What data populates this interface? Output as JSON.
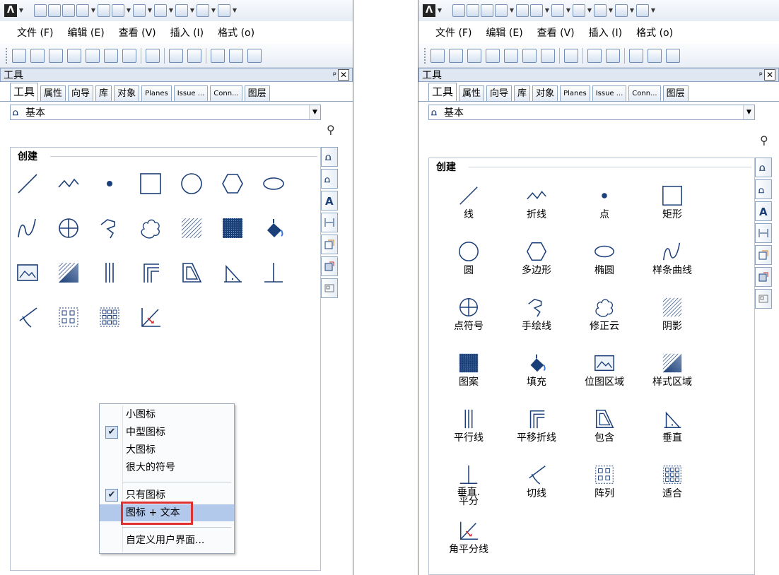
{
  "menu": {
    "file": "文件 (F)",
    "edit": "编辑 (E)",
    "view": "查看 (V)",
    "insert": "插入 (I)",
    "format": "格式 (o)"
  },
  "panel_title": "工具",
  "pin_glyph": "ᴘ",
  "close_glyph": "✕",
  "tabs": [
    "工具",
    "属性",
    "向导",
    "库",
    "对象",
    "Planes",
    "Issue ...",
    "Conn...",
    "图层"
  ],
  "combo_value": "基本",
  "group_title": "创建",
  "context_menu": {
    "small_icons": "小图标",
    "medium_icons": "中型图标",
    "large_icons": "大图标",
    "huge_icons": "很大的符号",
    "icons_only": "只有图标",
    "icons_text": "图标 + 文本",
    "customize": "自定义用户界面..."
  },
  "tools": [
    {
      "label": "线",
      "icon": "line-icon"
    },
    {
      "label": "折线",
      "icon": "polyline-icon"
    },
    {
      "label": "点",
      "icon": "point-icon"
    },
    {
      "label": "矩形",
      "icon": "rectangle-icon"
    },
    {
      "label": "圆",
      "icon": "circle-icon"
    },
    {
      "label": "多边形",
      "icon": "polygon-icon"
    },
    {
      "label": "椭圆",
      "icon": "ellipse-icon"
    },
    {
      "label": "样条曲线",
      "icon": "spline-icon"
    },
    {
      "label": "点符号",
      "icon": "point-symbol-icon"
    },
    {
      "label": "手绘线",
      "icon": "freehand-icon"
    },
    {
      "label": "修正云",
      "icon": "revision-cloud-icon"
    },
    {
      "label": "阴影",
      "icon": "hatch-icon"
    },
    {
      "label": "图案",
      "icon": "pattern-icon"
    },
    {
      "label": "填充",
      "icon": "fill-icon"
    },
    {
      "label": "位图区域",
      "icon": "bitmap-area-icon"
    },
    {
      "label": "样式区域",
      "icon": "style-area-icon"
    },
    {
      "label": "平行线",
      "icon": "parallel-line-icon"
    },
    {
      "label": "平移折线",
      "icon": "offset-polyline-icon"
    },
    {
      "label": "包含",
      "icon": "envelope-icon"
    },
    {
      "label": "垂直",
      "icon": "perpendicular-icon"
    },
    {
      "label": "垂直.\n平分",
      "icon": "perp-bisector-icon"
    },
    {
      "label": "切线",
      "icon": "tangent-icon"
    },
    {
      "label": "阵列",
      "icon": "array-icon"
    },
    {
      "label": "适合",
      "icon": "fit-icon"
    },
    {
      "label": "角平分线",
      "icon": "angle-bisector-icon"
    }
  ],
  "colors": {
    "accent": "#1b3f78",
    "highlight": "#b3c9ec",
    "red_box": "#e03030"
  }
}
